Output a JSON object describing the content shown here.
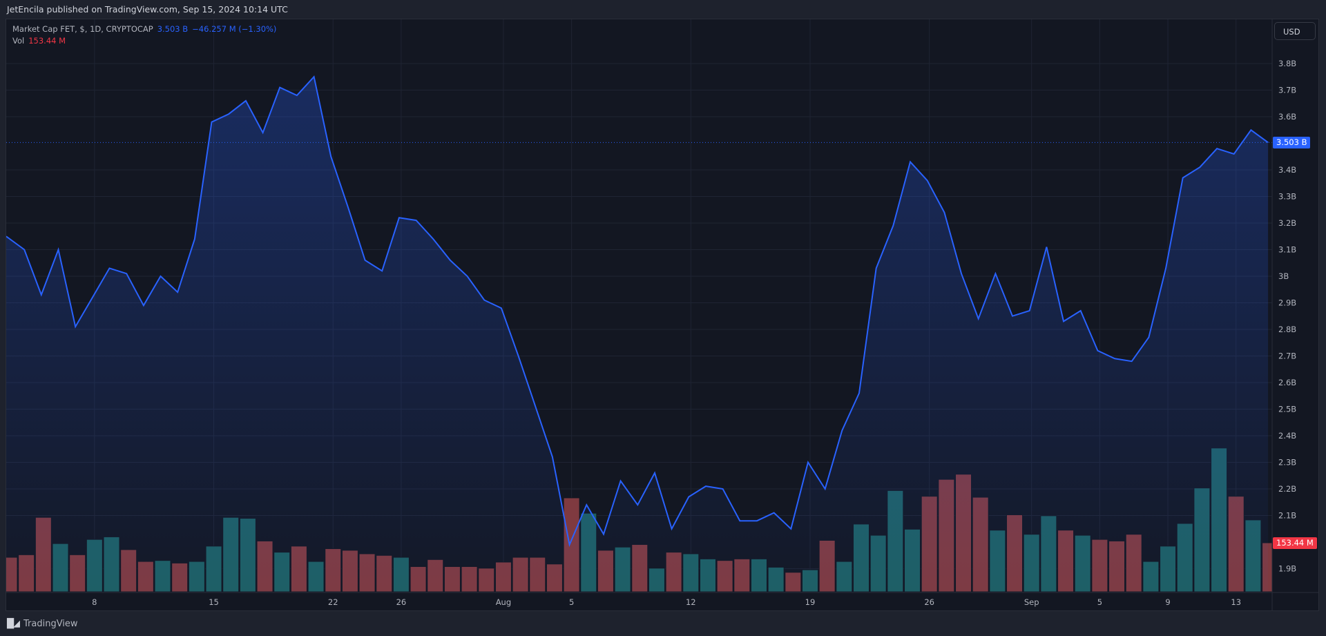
{
  "header": {
    "publisher": "JetEncila published on TradingView.com, Sep 15, 2024 10:14 UTC"
  },
  "legend": {
    "symbol": "Market Cap FET, $, 1D, CRYPTOCAP",
    "last": "3.503 B",
    "change": "−46.257 M (−1.30%)",
    "vol_label": "Vol",
    "vol_value": "153.44 M"
  },
  "currency_button": "USD",
  "price_tag": "3.503 B",
  "volume_tag": "153.44 M",
  "footer": {
    "brand": "TradingView",
    "logo": "17"
  },
  "colors": {
    "line": "#2962ff",
    "up": "#1e5f63",
    "down": "#7f3a40",
    "price_tag": "#2962ff",
    "volume_tag": "#f23645"
  },
  "chart_data": {
    "type": "line",
    "title": "Market Cap FET, $, 1D, CRYPTOCAP",
    "start_date": "Jul 3, 2024",
    "y_unit": "B USD",
    "ylim": [
      1.85,
      3.9
    ],
    "y_ticks": [
      {
        "v": 3.8,
        "label": "3.8B"
      },
      {
        "v": 3.7,
        "label": "3.7B"
      },
      {
        "v": 3.6,
        "label": "3.6B"
      },
      {
        "v": 3.4,
        "label": "3.4B"
      },
      {
        "v": 3.3,
        "label": "3.3B"
      },
      {
        "v": 3.2,
        "label": "3.2B"
      },
      {
        "v": 3.1,
        "label": "3.1B"
      },
      {
        "v": 3.0,
        "label": "3B"
      },
      {
        "v": 2.9,
        "label": "2.9B"
      },
      {
        "v": 2.8,
        "label": "2.8B"
      },
      {
        "v": 2.7,
        "label": "2.7B"
      },
      {
        "v": 2.6,
        "label": "2.6B"
      },
      {
        "v": 2.5,
        "label": "2.5B"
      },
      {
        "v": 2.4,
        "label": "2.4B"
      },
      {
        "v": 2.3,
        "label": "2.3B"
      },
      {
        "v": 2.2,
        "label": "2.2B"
      },
      {
        "v": 2.1,
        "label": "2.1B"
      },
      {
        "v": 1.9,
        "label": "1.9B"
      }
    ],
    "x_ticks": [
      {
        "day": 5,
        "label": "8"
      },
      {
        "day": 12,
        "label": "15"
      },
      {
        "day": 19,
        "label": "22"
      },
      {
        "day": 23,
        "label": "26"
      },
      {
        "day": 29,
        "label": "Aug"
      },
      {
        "day": 33,
        "label": "5"
      },
      {
        "day": 40,
        "label": "12"
      },
      {
        "day": 47,
        "label": "19"
      },
      {
        "day": 54,
        "label": "26"
      },
      {
        "day": 60,
        "label": "Sep"
      },
      {
        "day": 64,
        "label": "5"
      },
      {
        "day": 68,
        "label": "9"
      },
      {
        "day": 72,
        "label": "13"
      }
    ],
    "market_cap": [
      3.15,
      3.1,
      2.93,
      3.1,
      2.81,
      2.92,
      3.03,
      3.01,
      2.89,
      3.0,
      2.94,
      3.14,
      3.58,
      3.61,
      3.66,
      3.54,
      3.71,
      3.68,
      3.75,
      3.45,
      3.26,
      3.06,
      3.02,
      3.22,
      3.21,
      3.14,
      3.06,
      3.0,
      2.91,
      2.88,
      2.7,
      2.51,
      2.32,
      1.99,
      2.14,
      2.03,
      2.23,
      2.14,
      2.26,
      2.05,
      2.17,
      2.21,
      2.2,
      2.08,
      2.08,
      2.11,
      2.05,
      2.3,
      2.2,
      2.42,
      2.56,
      3.03,
      3.19,
      3.43,
      3.36,
      3.24,
      3.01,
      2.84,
      3.01,
      2.85,
      2.87,
      3.11,
      2.83,
      2.87,
      2.72,
      2.69,
      2.68,
      2.77,
      3.03,
      3.37,
      3.41,
      3.48,
      3.46,
      3.55,
      3.503
    ],
    "volume_m": [
      108,
      116,
      233,
      151,
      116,
      164,
      172,
      132,
      95,
      98,
      90,
      95,
      143,
      233,
      230,
      159,
      124,
      143,
      95,
      135,
      130,
      119,
      114,
      108,
      79,
      101,
      79,
      79,
      74,
      93,
      108,
      108,
      87,
      294,
      246,
      130,
      140,
      148,
      74,
      124,
      119,
      103,
      98,
      103,
      103,
      77,
      61,
      69,
      161,
      95,
      212,
      177,
      317,
      196,
      299,
      352,
      368,
      296,
      193,
      241,
      180,
      238,
      193,
      177,
      164,
      159,
      180,
      95,
      143,
      214,
      325,
      450,
      299,
      225,
      153.44
    ],
    "volume_max_m": 520
  }
}
